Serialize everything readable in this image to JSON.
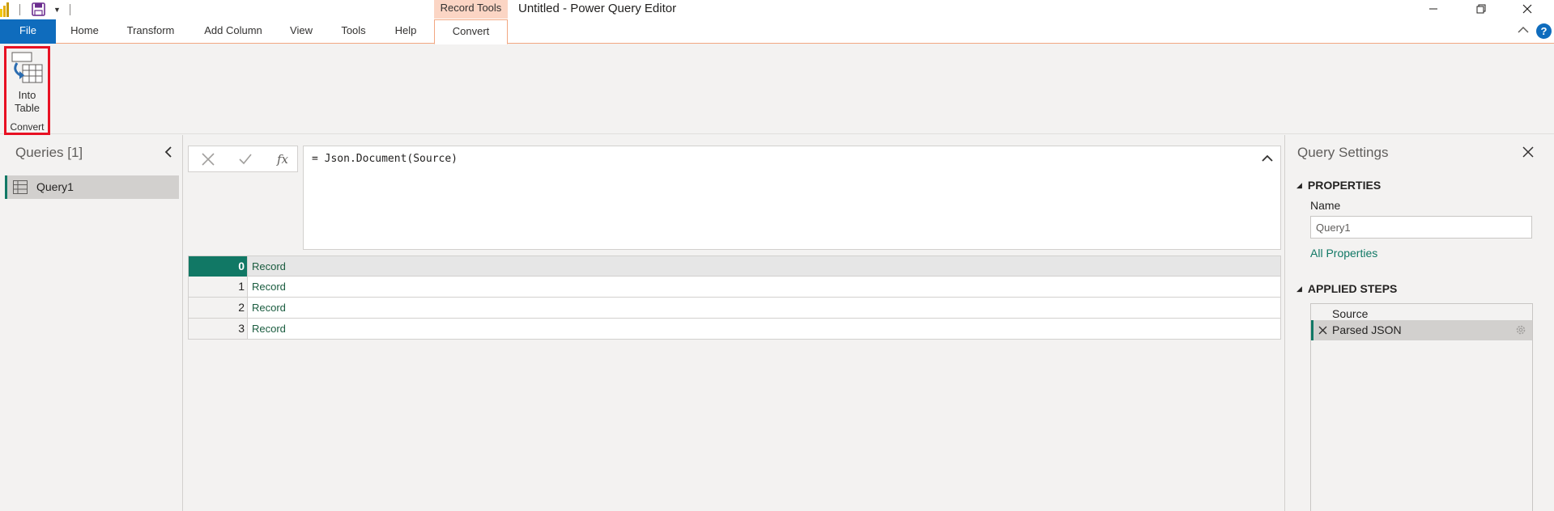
{
  "window": {
    "title": "Untitled - Power Query Editor",
    "contextual_tab_group": "Record Tools"
  },
  "tabs": [
    {
      "label": "File"
    },
    {
      "label": "Home"
    },
    {
      "label": "Transform"
    },
    {
      "label": "Add Column"
    },
    {
      "label": "View"
    },
    {
      "label": "Tools"
    },
    {
      "label": "Help"
    },
    {
      "label": "Convert"
    }
  ],
  "ribbon": {
    "into_table_label": "Into Table",
    "group_label": "Convert"
  },
  "queries": {
    "title": "Queries [1]",
    "items": [
      {
        "label": "Query1"
      }
    ]
  },
  "formula": {
    "fx_label": "fx",
    "text": "= Json.Document(Source)"
  },
  "grid": {
    "rows": [
      {
        "index": "0",
        "value": "Record"
      },
      {
        "index": "1",
        "value": "Record"
      },
      {
        "index": "2",
        "value": "Record"
      },
      {
        "index": "3",
        "value": "Record"
      }
    ]
  },
  "settings": {
    "title": "Query Settings",
    "properties_header": "PROPERTIES",
    "name_label": "Name",
    "name_value": "Query1",
    "all_properties": "All Properties",
    "applied_steps_header": "APPLIED STEPS",
    "steps": [
      {
        "label": "Source"
      },
      {
        "label": "Parsed JSON"
      }
    ]
  },
  "colors": {
    "accent_teal": "#117865",
    "file_tab_blue": "#0f6cbd",
    "contextual_orange": "#fbd5c4",
    "highlight_red": "#e81123"
  }
}
